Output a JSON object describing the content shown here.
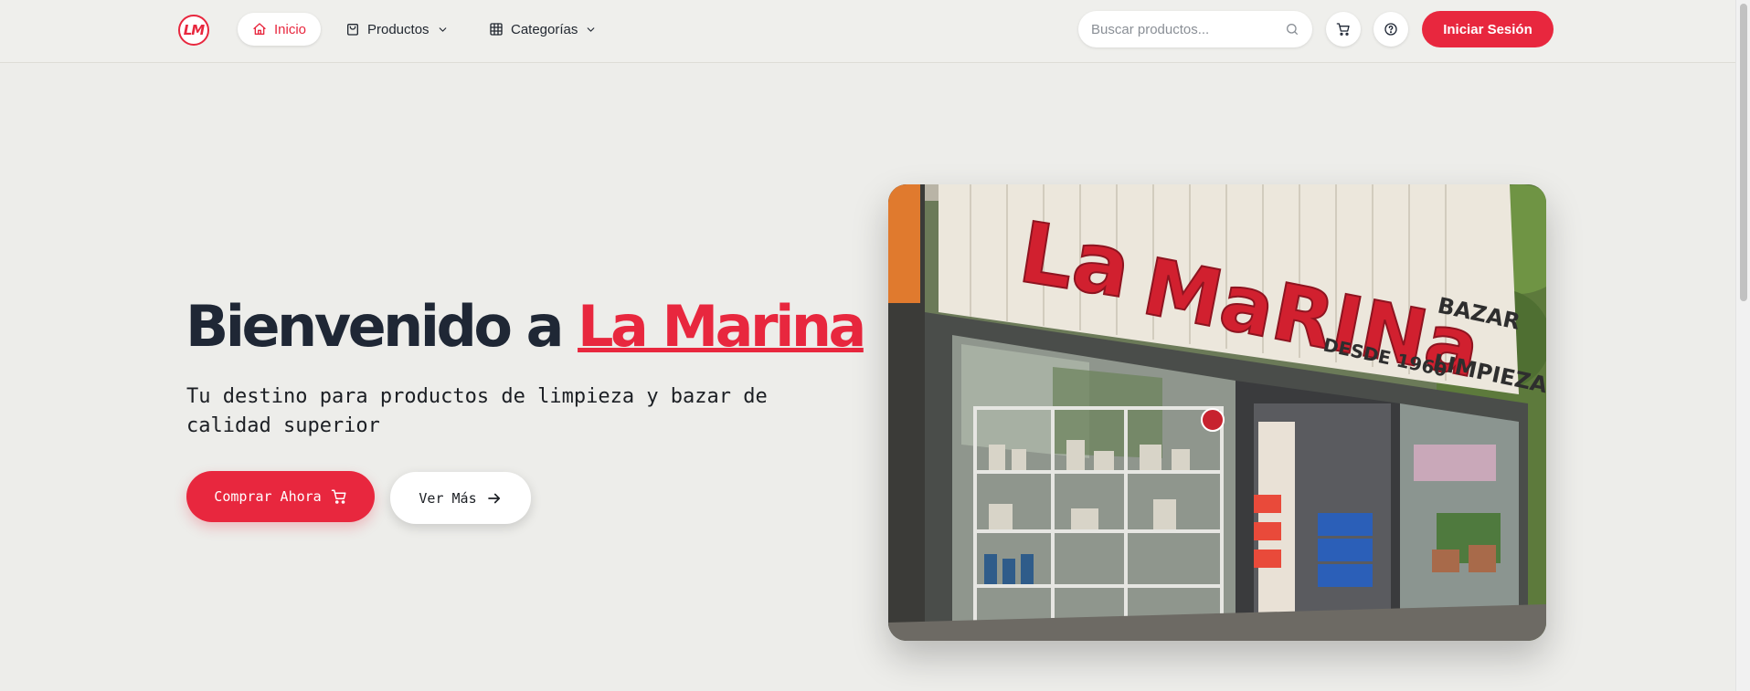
{
  "nav": {
    "logo_text": "LM",
    "items": [
      {
        "label": "Inicio",
        "icon": "home-icon",
        "active": true
      },
      {
        "label": "Productos",
        "icon": "bag-icon",
        "dropdown": true
      },
      {
        "label": "Categorías",
        "icon": "grid-icon",
        "dropdown": true
      }
    ],
    "search_placeholder": "Buscar productos...",
    "login_label": "Iniciar Sesión"
  },
  "hero": {
    "title_prefix": "Bienvenido a ",
    "title_brand": "La Marina",
    "subtitle": "Tu destino para productos de limpieza y bazar de calidad superior",
    "primary_button": "Comprar Ahora",
    "secondary_button": "Ver Más"
  },
  "storefront": {
    "sign": "La Marina",
    "sign_side_1": "BAZAR",
    "sign_side_2": "LIMPIEZA",
    "sign_since": "DESDE 1960"
  },
  "colors": {
    "accent": "#e8273e",
    "background": "#ededea",
    "text_dark": "#1f2735"
  }
}
